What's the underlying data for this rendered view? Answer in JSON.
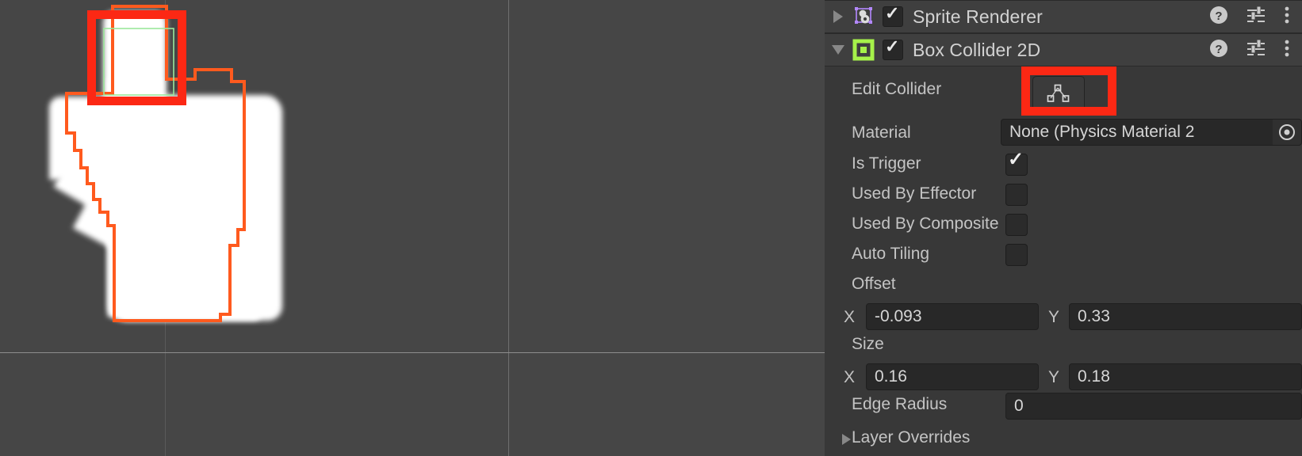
{
  "scene": {
    "name": "scene-view",
    "background_color": "#464646",
    "sprite_outline_color": "#ff5a1e",
    "collider_outline_color": "#9be89b",
    "highlight_color": "#fc2814",
    "grid_color": "#5a5a5a",
    "axis_color": "#8d8d8d",
    "sprite_label": "hand-cursor-sprite"
  },
  "inspector": {
    "components": [
      {
        "title": "Sprite Renderer",
        "expanded": false,
        "enabled": true,
        "foldout_icon": "chevron-right-icon",
        "component_icon": "sprite-renderer-icon",
        "icon_color": "#b388ff",
        "help_icon": "help-icon",
        "preset_icon": "preset-sliders-icon",
        "menu_icon": "kebab-menu-icon"
      },
      {
        "title": "Box Collider 2D",
        "expanded": true,
        "enabled": true,
        "foldout_icon": "chevron-down-icon",
        "component_icon": "box-collider-2d-icon",
        "icon_color": "#a6f24a",
        "help_icon": "help-icon",
        "preset_icon": "preset-sliders-icon",
        "menu_icon": "kebab-menu-icon"
      }
    ],
    "box_collider": {
      "edit_collider": {
        "label": "Edit Collider",
        "button_icon": "polygon-edit-icon",
        "highlighted": true
      },
      "material": {
        "label": "Material",
        "value": "None (Physics Material 2",
        "picker_icon": "object-picker-icon"
      },
      "is_trigger": {
        "label": "Is Trigger",
        "checked": true
      },
      "used_by_effector": {
        "label": "Used By Effector",
        "checked": false
      },
      "used_by_composite": {
        "label": "Used By Composite",
        "checked": false
      },
      "auto_tiling": {
        "label": "Auto Tiling",
        "checked": false
      },
      "offset": {
        "label": "Offset",
        "x_label": "X",
        "x_value": "-0.093",
        "y_label": "Y",
        "y_value": "0.33"
      },
      "size": {
        "label": "Size",
        "x_label": "X",
        "x_value": "0.16",
        "y_label": "Y",
        "y_value": "0.18"
      },
      "edge_radius": {
        "label": "Edge Radius",
        "value": "0"
      },
      "layer_overrides": {
        "label": "Layer Overrides",
        "foldout_icon": "chevron-right-icon"
      }
    }
  }
}
